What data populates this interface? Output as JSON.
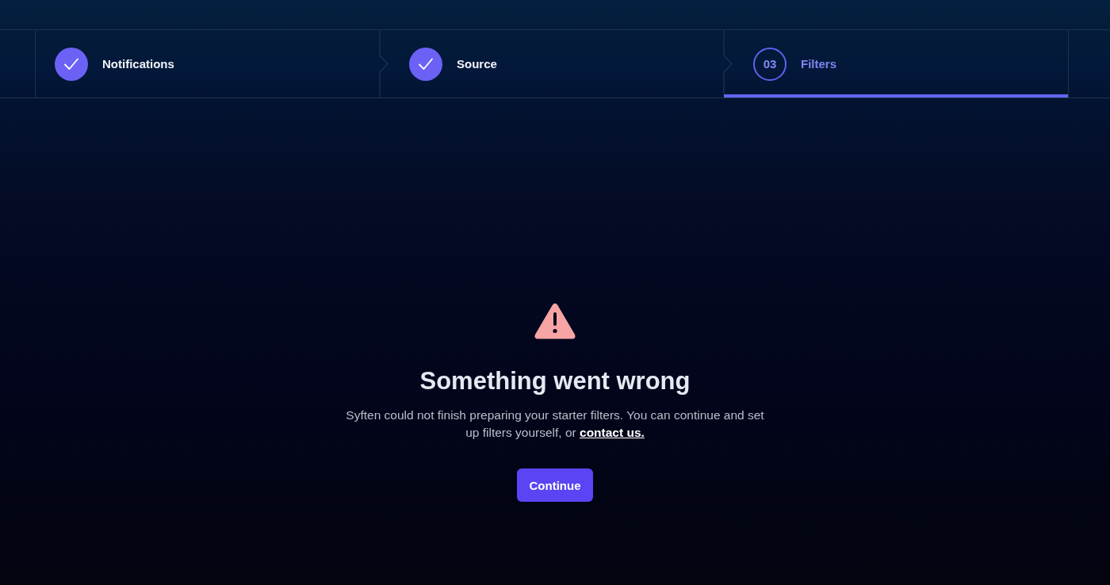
{
  "stepper": {
    "steps": [
      {
        "label": "Notifications",
        "completed": true,
        "selected": false
      },
      {
        "label": "Source",
        "completed": true,
        "selected": false
      },
      {
        "label": "Filters",
        "number": "03",
        "completed": false,
        "selected": true
      }
    ]
  },
  "error": {
    "title": "Something went wrong",
    "message": "Syften could not finish preparing your starter filters. You can continue and set up filters yourself, or ",
    "link": "contact us.",
    "button": "Continue"
  }
}
